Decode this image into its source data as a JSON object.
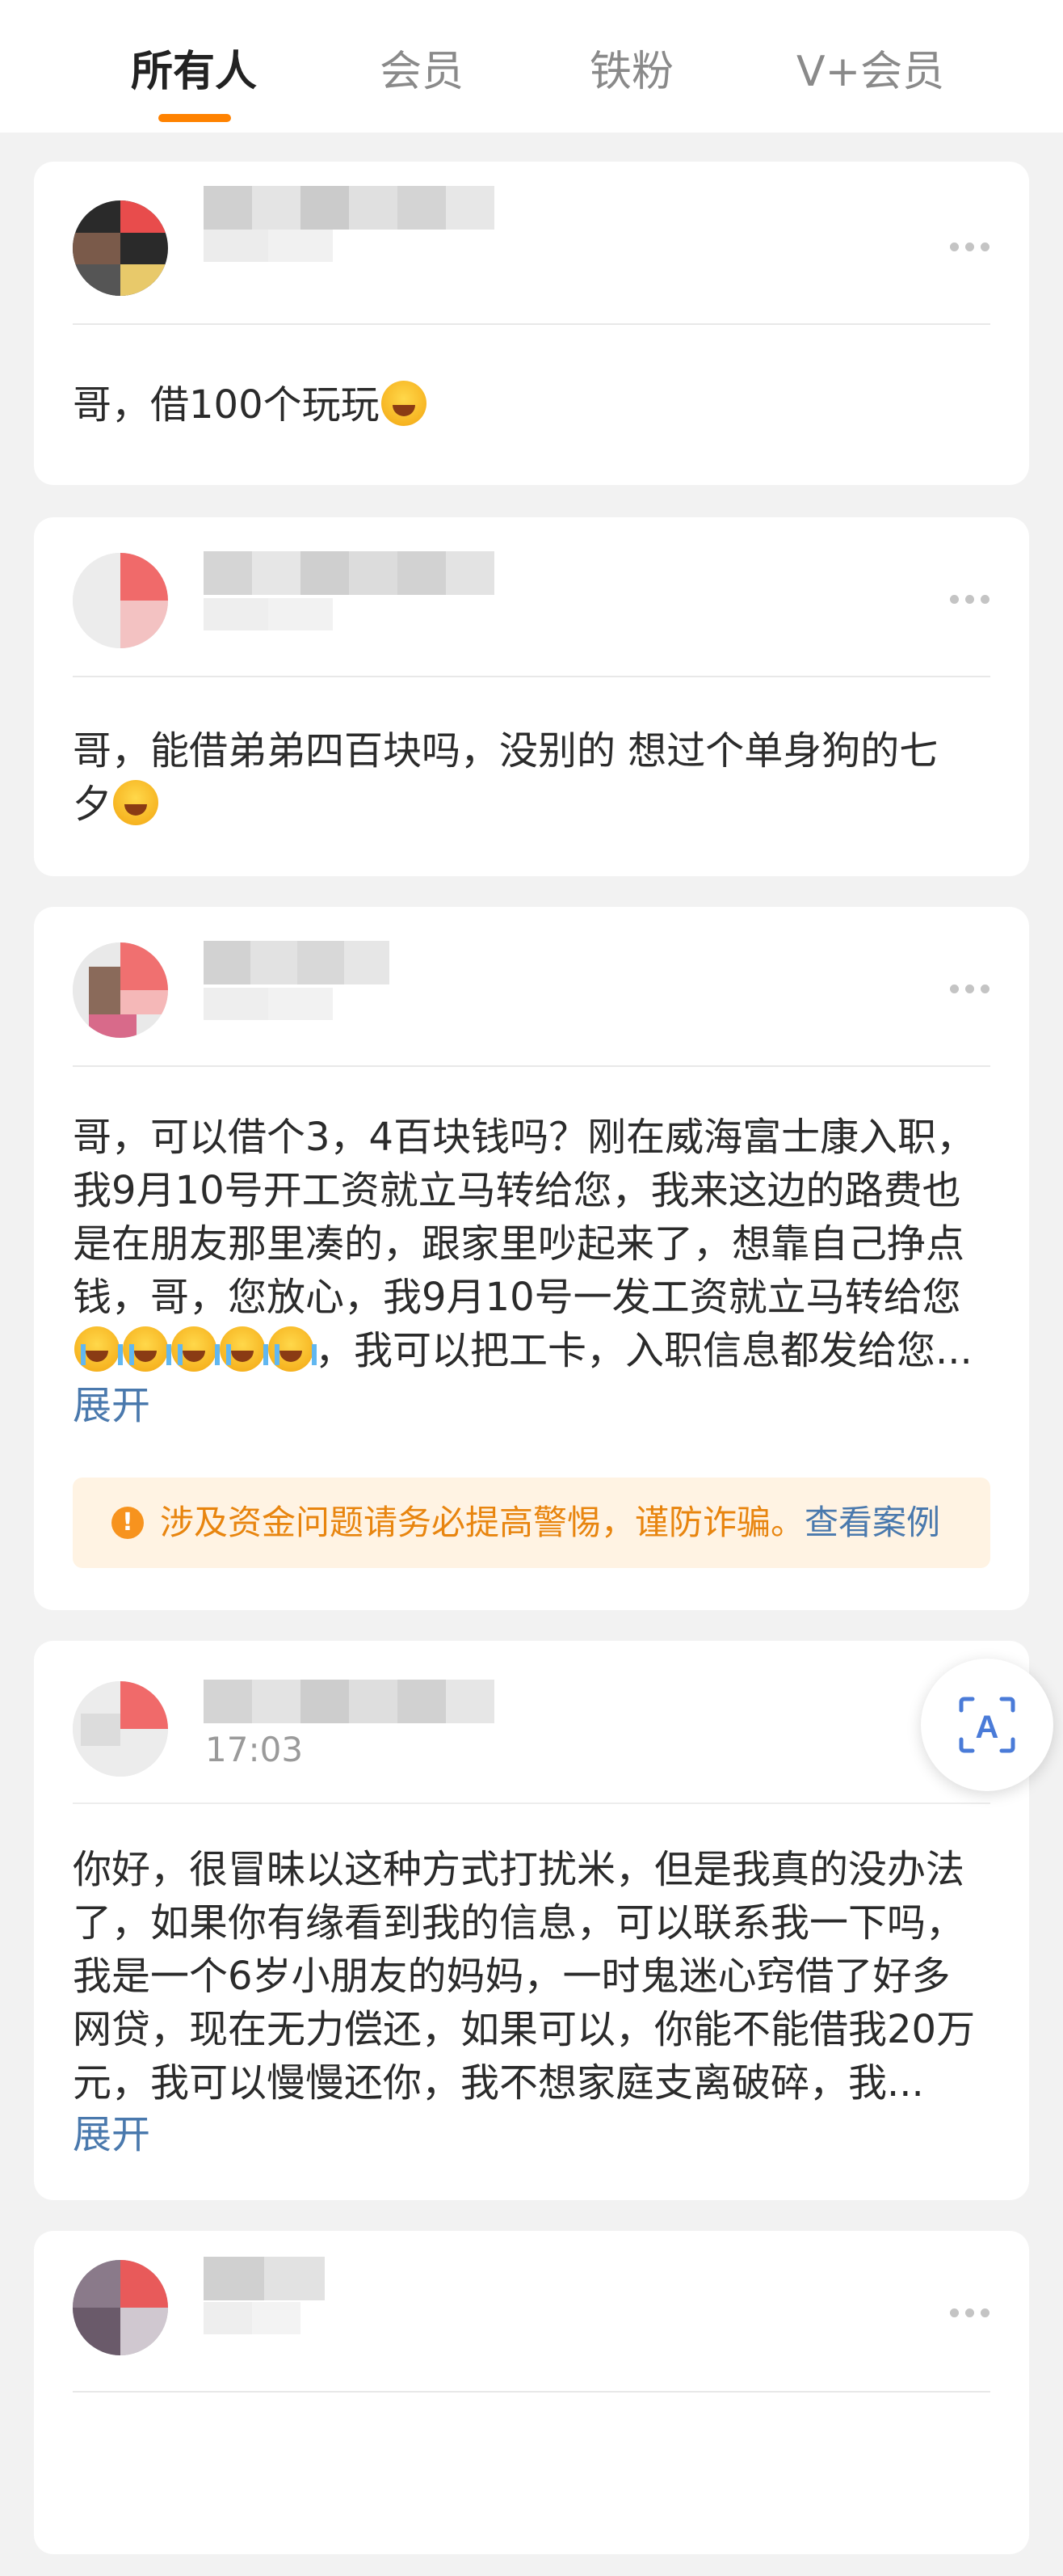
{
  "tabs": [
    {
      "label": "所有人",
      "active": true
    },
    {
      "label": "会员",
      "active": false
    },
    {
      "label": "铁粉",
      "active": false
    },
    {
      "label": "V+会员",
      "active": false
    }
  ],
  "colors": {
    "accent": "#ff8200",
    "link": "#4a79ad",
    "warning_text": "#e8850f",
    "warning_bg": "#fff3e3"
  },
  "messages": [
    {
      "text": "哥，借100个玩玩",
      "emoji": "grinning-face"
    },
    {
      "line1": "哥，能借弟弟四百块吗，没别的 想过个单身狗的七",
      "line2": "夕",
      "emoji": "smiling-face-with-hearts"
    },
    {
      "lines": [
        "哥，可以借个3，4百块钱吗？刚在威海富士康入职，",
        "我9月10号开工资就立马转给您，我来这边的路费也",
        "是在朋友那里凑的，跟家里吵起来了，想靠自己挣点",
        "钱，哥，您放心，我9月10号一发工资就立马转给您"
      ],
      "tail": "，我可以把工卡，入职信息都发给您...",
      "emoji": "loudly-crying-face",
      "expand": "展开",
      "warning": {
        "icon": "info-icon",
        "text": "涉及资金问题请务必提高警惕，谨防诈骗。",
        "link": "查看案例"
      }
    },
    {
      "time": "17:03",
      "lines": [
        "你好，很冒昧以这种方式打扰米，但是我真的没办法",
        "了，如果你有缘看到我的信息，可以联系我一下吗，",
        "我是一个6岁小朋友的妈妈，一时鬼迷心窍借了好多",
        "网贷，现在无力偿还，如果可以，你能不能借我20万",
        "元，我可以慢慢还你，我不想家庭支离破碎，我..."
      ],
      "expand": "展开"
    }
  ],
  "floating_button": {
    "icon": "translate-icon",
    "glyph": "A"
  }
}
